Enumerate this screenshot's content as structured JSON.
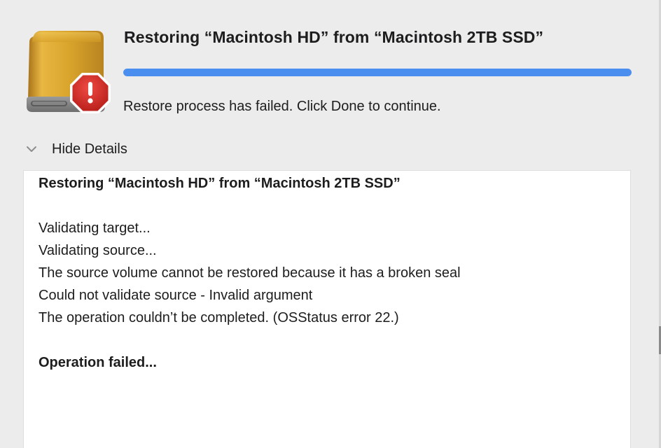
{
  "header": {
    "title": "Restoring “Macintosh HD” from “Macintosh 2TB SSD”",
    "progress_fraction": 1.0,
    "status_text": "Restore process has failed. Click Done to continue.",
    "icon": "external-drive-with-alert-icon"
  },
  "details": {
    "toggle_label": "Hide Details",
    "expanded": true,
    "log_title": "Restoring “Macintosh HD” from “Macintosh 2TB SSD”",
    "lines": [
      "Validating target...",
      "Validating source...",
      "The source volume cannot be restored because it has a broken seal",
      "Could not validate source - Invalid argument",
      "The operation couldn’t be completed. (OSStatus error 22.)"
    ],
    "result": "Operation failed..."
  },
  "colors": {
    "window_background": "#ececec",
    "progress_fill": "#4a8ff0",
    "progress_track": "#d8d8d8",
    "alert_red": "#d12a26",
    "drive_gold": "#d9a42b"
  }
}
